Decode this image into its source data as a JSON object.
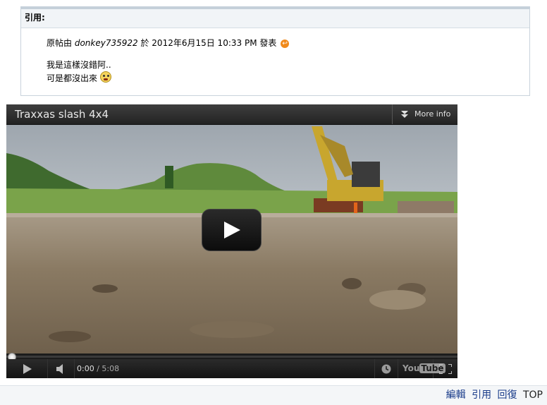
{
  "quote": {
    "header": "引用:",
    "meta_prefix": "原帖由",
    "author": "donkey735922",
    "meta_suffix": "於 2012年6月15日 10:33 PM 發表",
    "lines": [
      "我是這樣沒錯阿..",
      "可是都沒出來"
    ]
  },
  "player": {
    "title": "Traxxas slash 4x4",
    "more_info": "More info",
    "time_current": "0:00",
    "time_separator": " / ",
    "time_total": "5:08",
    "progress": 0,
    "youtube_logo": "YouTube"
  },
  "footer": {
    "edit": "編輯",
    "quote": "引用",
    "reply": "回復",
    "top": "TOP"
  },
  "colors": {
    "link": "#1a3c8a",
    "accent_orange": "#f08a1c"
  }
}
